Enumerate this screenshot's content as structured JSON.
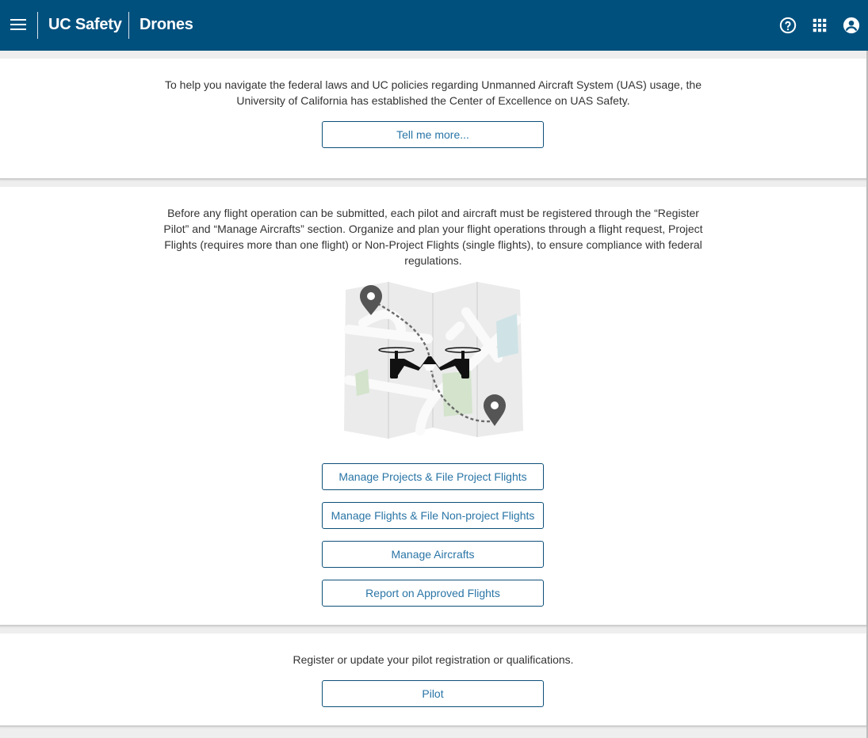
{
  "header": {
    "app_name": "UC Safety",
    "section_name": "Drones",
    "icons": [
      "menu-icon",
      "help-icon",
      "apps-grid-icon",
      "account-icon"
    ],
    "background": "#00507e"
  },
  "intro": {
    "text": "To help you navigate the federal laws and UC policies regarding Unmanned Aircraft System (UAS) usage, the University of California has established the Center of Excellence on UAS Safety.",
    "button": "Tell me more..."
  },
  "flights": {
    "text": "Before any flight operation can be submitted, each pilot and aircraft must be registered through the “Register Pilot” and “Manage Aircrafts” section. Organize and plan your flight operations through a flight request, Project Flights (requires more than one flight) or Non-Project Flights (single flights), to ensure compliance with federal regulations.",
    "buttons": [
      "Manage Projects & File Project Flights",
      "Manage Flights & File Non-project Flights",
      "Manage Aircrafts",
      "Report on Approved Flights"
    ]
  },
  "pilot": {
    "text": "Register or update your pilot registration or qualifications.",
    "button": "Pilot"
  },
  "colors": {
    "accent": "#2a75a6",
    "button_border": "#0d4f79",
    "page_background": "#eeeeee"
  }
}
